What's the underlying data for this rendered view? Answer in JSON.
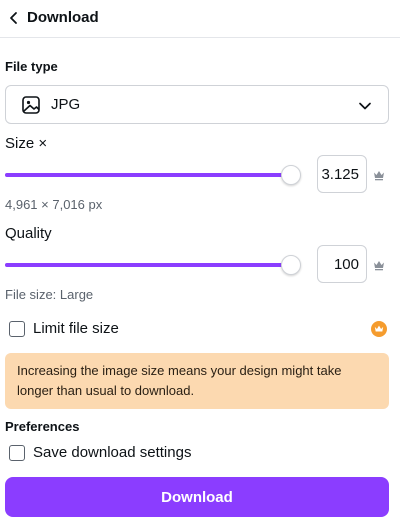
{
  "header": {
    "title": "Download"
  },
  "file_type": {
    "label": "File type",
    "selected": "JPG"
  },
  "size": {
    "label": "Size ×",
    "value": "3.125",
    "level": 1.0,
    "dimensions": "4,961 × 7,016 px"
  },
  "quality": {
    "label": "Quality",
    "value": "100",
    "level": 1.0,
    "file_size": "File size: Large"
  },
  "limit_file_size": {
    "label": "Limit file size",
    "checked": false
  },
  "warning": {
    "text": "Increasing the image size means your design might take longer than usual to download."
  },
  "preferences": {
    "label": "Preferences",
    "save_settings_label": "Save download settings",
    "checked": false
  },
  "download_button": {
    "label": "Download"
  },
  "colors": {
    "accent": "#8b3dff",
    "warning_bg": "#fcd9b0",
    "pro_badge": "#f59c2e"
  },
  "icons": [
    "chevron-left-icon",
    "image-icon",
    "chevron-down-icon",
    "crown-icon",
    "pro-crown-icon"
  ]
}
